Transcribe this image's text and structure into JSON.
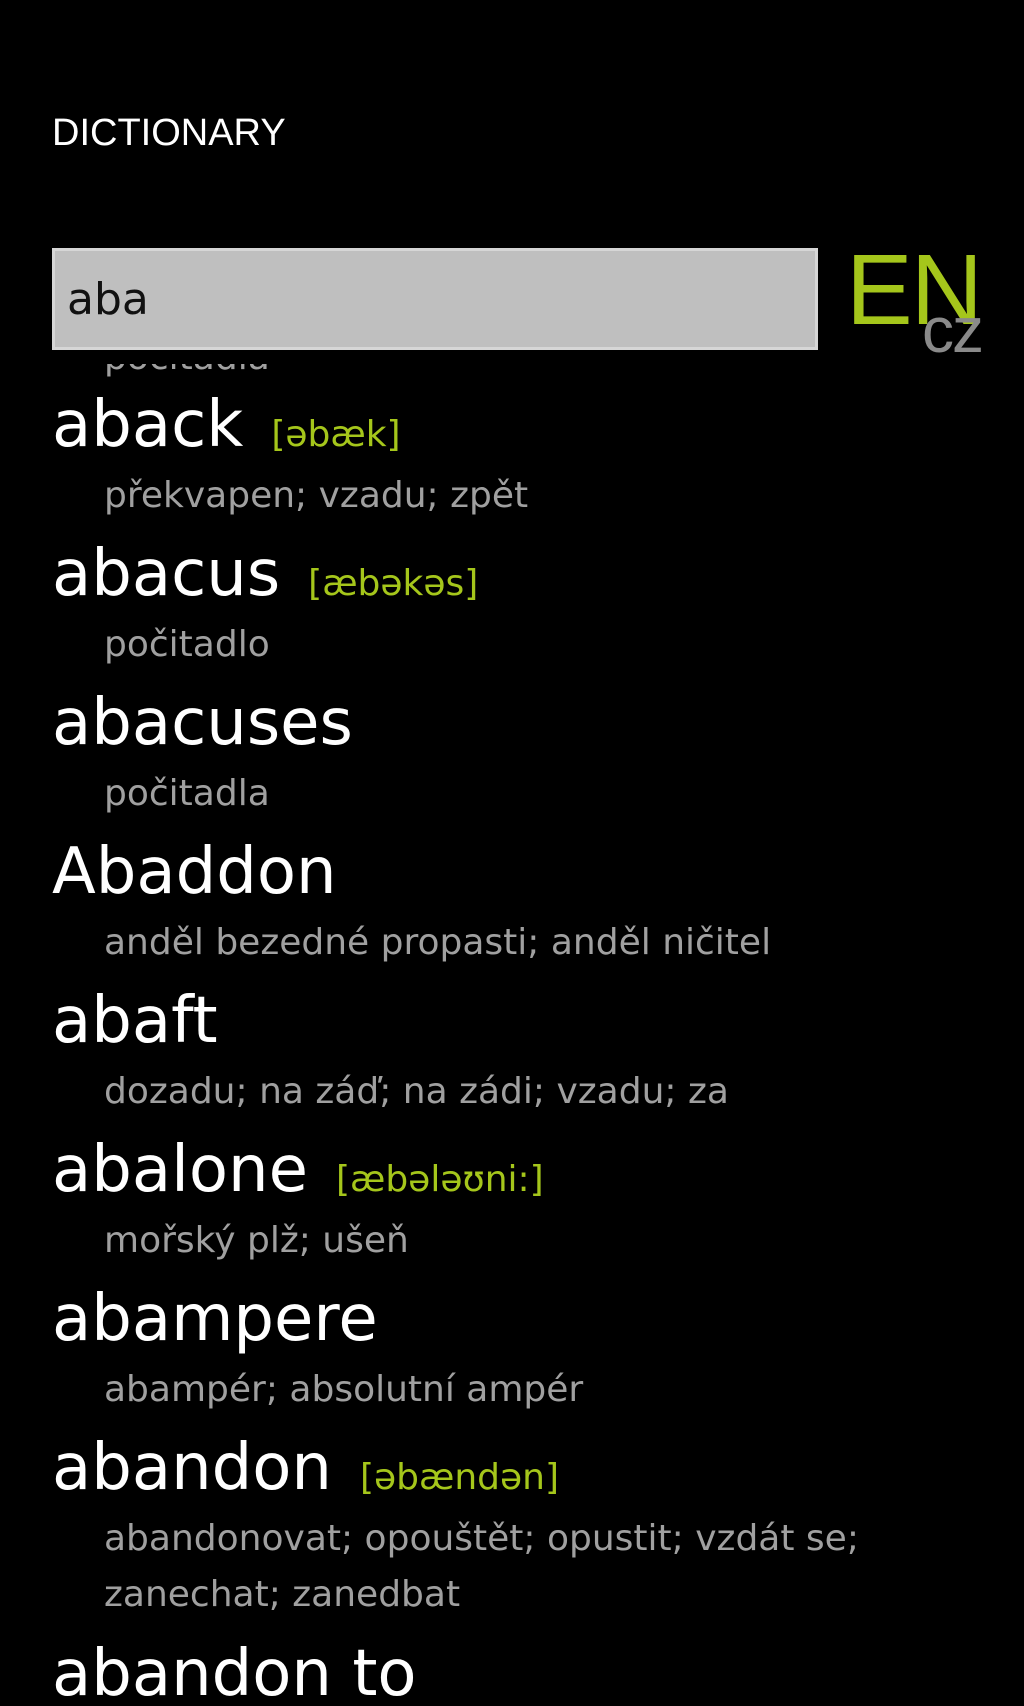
{
  "header": {
    "title": "DICTIONARY"
  },
  "search": {
    "value": "aba"
  },
  "language": {
    "from": "EN",
    "to": "cz",
    "accent_color": "#a5c61b"
  },
  "results": {
    "partial_top_text": "počitadla",
    "entries": [
      {
        "word": "aback",
        "pron": "[əbæk]",
        "translation": "překvapen; vzadu; zpět"
      },
      {
        "word": "abacus",
        "pron": "[æbəkəs]",
        "translation": "počitadlo"
      },
      {
        "word": "abacuses",
        "pron": "",
        "translation": "počitadla"
      },
      {
        "word": "Abaddon",
        "pron": "",
        "translation": "anděl bezedné propasti; anděl ničitel"
      },
      {
        "word": "abaft",
        "pron": "",
        "translation": "dozadu; na záď; na zádi; vzadu; za"
      },
      {
        "word": "abalone",
        "pron": "[æbələʊni:]",
        "translation": "mořský plž; ušeň"
      },
      {
        "word": "abampere",
        "pron": "",
        "translation": "abampér; absolutní ampér"
      },
      {
        "word": "abandon",
        "pron": "[əbændən]",
        "translation": "abandonovat; opouštět; opustit; vzdát se; zanechat; zanedbat"
      },
      {
        "word": "abandon to",
        "pron": "",
        "translation": ""
      }
    ]
  }
}
